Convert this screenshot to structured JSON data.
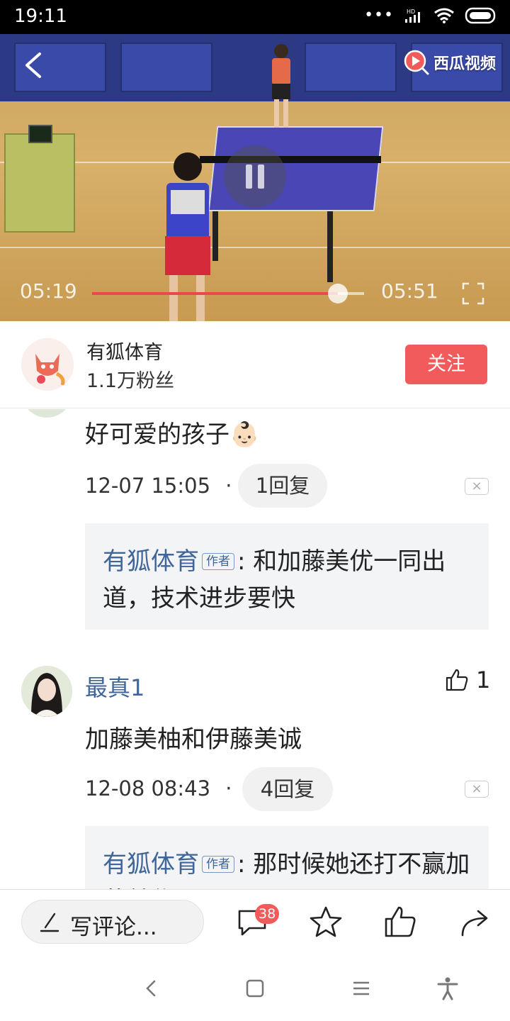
{
  "status_bar": {
    "time": "19:11",
    "network": "HD"
  },
  "video": {
    "brand": "西瓜视频",
    "current_time": "05:19",
    "duration": "05:51",
    "progress": 0.904
  },
  "author": {
    "name": "有狐体育",
    "fans": "1.1万粉丝",
    "follow_label": "关注"
  },
  "comments": [
    {
      "text": "好可爱的孩子👶🏻",
      "time": "12-07 15:05",
      "separator": "·",
      "replies_label": "1回复",
      "dismiss": "×",
      "author_reply": {
        "name": "有狐体育",
        "tag": "作者",
        "text": ": 和加藤美优一同出道，技术进步要快"
      }
    },
    {
      "user": "最真1",
      "likes": "1",
      "text": "加藤美柚和伊藤美诚",
      "time": "12-08 08:43",
      "separator": "·",
      "replies_label": "4回复",
      "dismiss": "×",
      "author_reply": {
        "name": "有狐体育",
        "tag": "作者",
        "text": ": 那时候她还打不赢加藤美优😂"
      }
    }
  ],
  "action_bar": {
    "write_placeholder": "写评论...",
    "comment_count": "38"
  },
  "colors": {
    "accent": "#f25b5b",
    "link_blue": "#406599",
    "reply_bg": "#f3f4f6"
  }
}
